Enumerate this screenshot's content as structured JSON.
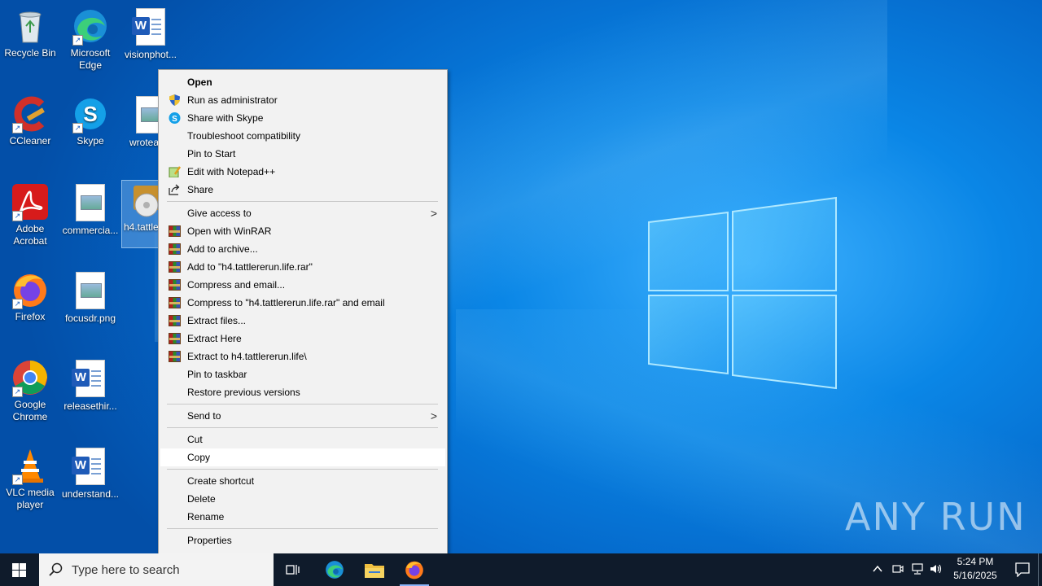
{
  "desktop": {
    "icons": [
      {
        "label": "Recycle Bin"
      },
      {
        "label": "Microsoft Edge"
      },
      {
        "label": "visionphot..."
      },
      {
        "label": "CCleaner"
      },
      {
        "label": "Skype"
      },
      {
        "label": "wroteac..."
      },
      {
        "label": "Adobe Acrobat"
      },
      {
        "label": "commercia..."
      },
      {
        "label": "h4.tattle...life.e..."
      },
      {
        "label": "Firefox"
      },
      {
        "label": "focusdr.png"
      },
      {
        "label": "Google Chrome"
      },
      {
        "label": "releasethir..."
      },
      {
        "label": "VLC media player"
      },
      {
        "label": "understand..."
      }
    ]
  },
  "context_menu": {
    "items": [
      {
        "label": "Open",
        "icon": "",
        "bold": true
      },
      {
        "label": "Run as administrator",
        "icon": "uac-shield-icon"
      },
      {
        "label": "Share with Skype",
        "icon": "skype-icon"
      },
      {
        "label": "Troubleshoot compatibility",
        "icon": ""
      },
      {
        "label": "Pin to Start",
        "icon": ""
      },
      {
        "label": "Edit with Notepad++",
        "icon": "notepadpp-icon"
      },
      {
        "label": "Share",
        "icon": "share-icon"
      },
      {
        "label": "Give access to",
        "icon": "",
        "submenu": true
      },
      {
        "label": "Open with WinRAR",
        "icon": "winrar-icon"
      },
      {
        "label": "Add to archive...",
        "icon": "winrar-icon"
      },
      {
        "label": "Add to \"h4.tattlererun.life.rar\"",
        "icon": "winrar-icon"
      },
      {
        "label": "Compress and email...",
        "icon": "winrar-icon"
      },
      {
        "label": "Compress to \"h4.tattlererun.life.rar\" and email",
        "icon": "winrar-icon"
      },
      {
        "label": "Extract files...",
        "icon": "winrar-icon"
      },
      {
        "label": "Extract Here",
        "icon": "winrar-icon"
      },
      {
        "label": "Extract to h4.tattlererun.life\\",
        "icon": "winrar-icon"
      },
      {
        "label": "Pin to taskbar",
        "icon": ""
      },
      {
        "label": "Restore previous versions",
        "icon": ""
      },
      {
        "label": "Send to",
        "icon": "",
        "submenu": true
      },
      {
        "label": "Cut",
        "icon": ""
      },
      {
        "label": "Copy",
        "icon": "",
        "highlighted": true
      },
      {
        "label": "Create shortcut",
        "icon": ""
      },
      {
        "label": "Delete",
        "icon": ""
      },
      {
        "label": "Rename",
        "icon": ""
      },
      {
        "label": "Properties",
        "icon": ""
      }
    ],
    "submenu_arrow": ">"
  },
  "taskbar": {
    "search_placeholder": "Type here to search",
    "pinned": [
      "task-view-icon",
      "edge-icon",
      "file-explorer-icon",
      "firefox-icon"
    ],
    "tray_icons": [
      "chevron-up-icon",
      "meet-now-icon",
      "network-icon",
      "volume-icon"
    ],
    "time": "5:24 PM",
    "date": "5/16/2025"
  },
  "watermark": {
    "text": "ANY RUN"
  },
  "colors": {
    "desktop_blue": "#0a86e6",
    "taskbar": "#0f1b2b",
    "menu_bg": "#f2f2f2",
    "menu_highlight": "#ffffff"
  }
}
